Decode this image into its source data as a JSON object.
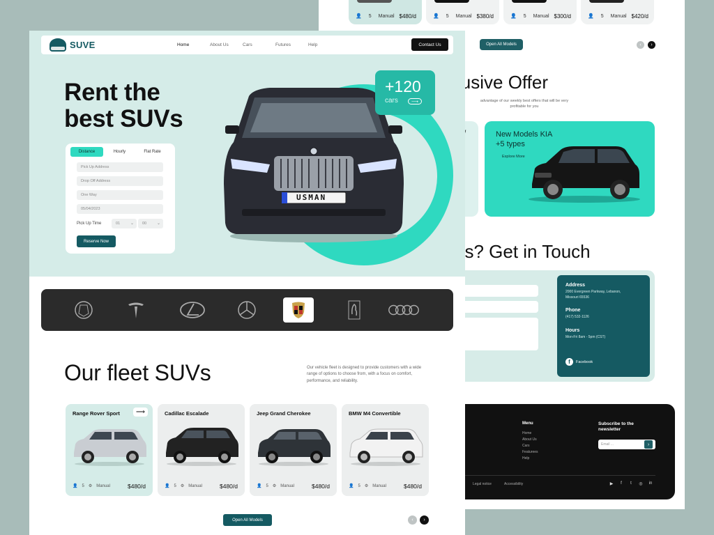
{
  "colors": {
    "teal": "#2fd9c0",
    "dark_teal": "#155a62",
    "mint": "#d5ece8",
    "dark": "#111111"
  },
  "back": {
    "top_cards": [
      {
        "seats": "5",
        "transmission": "Manual",
        "price": "$480/d"
      },
      {
        "seats": "5",
        "transmission": "Manual",
        "price": "$380/d"
      },
      {
        "seats": "5",
        "transmission": "Manual",
        "price": "$300/d"
      },
      {
        "seats": "5",
        "transmission": "Manual",
        "price": "$420/d"
      }
    ],
    "open_all_label": "Open All Models",
    "offer": {
      "title": "clusive Offer",
      "desc": "advantage of our weekly best offers that will be very profitable for you",
      "left_card_text": "E\n/",
      "card_title": "New Models KIA",
      "card_subtitle": "+5 types",
      "card_link": "Explore More"
    },
    "touch": {
      "title": "ns? Get in Touch",
      "field_name_placeholder": "n",
      "address_h": "Address",
      "address_v": "2000 Evergreen Parkway, Lebanon, Missouri 65536",
      "phone_h": "Phone",
      "phone_v": "(417) 532-1126",
      "hours_h": "Hours",
      "hours_v": "Mon-Fri 8am - 5pm (CST)",
      "facebook": "Facebook"
    },
    "footer": {
      "col1_heading": "ks",
      "menu_heading": "Menu",
      "menu_items": [
        "Home",
        "About Us",
        "Cars",
        "Featurees",
        "Help"
      ],
      "subscribe": "Subscribe to the newsletter",
      "email_placeholder": "Email ...",
      "legal": "Legal notice",
      "accessibility": "Accessibility"
    }
  },
  "front": {
    "logo": "SUVE",
    "nav": [
      "Home",
      "About Us",
      "Cars",
      "Futures",
      "Help"
    ],
    "contact_label": "Contact Us",
    "hero_title_1": "Rent the",
    "hero_title_2": "best SUVs",
    "badge_number": "+120",
    "badge_label": "cars",
    "plate": "USMAN",
    "booking": {
      "tabs": [
        "Distance",
        "Hourly",
        "Flat Rate"
      ],
      "pickup_placeholder": "Pick Up Address",
      "dropoff_placeholder": "Drop Off Address",
      "trip_type": "One Way",
      "date": "05/04/2023",
      "pickup_time_label": "Pick Up Time",
      "hour": "01",
      "minute": "00",
      "reserve_label": "Reserve Now"
    },
    "brands": [
      "Cadillac",
      "Tesla",
      "Lexus",
      "Mercedes-Benz",
      "Porsche",
      "Ferrari",
      "Audi"
    ],
    "fleet_title": "Our fleet SUVs",
    "fleet_desc": "Our vehicle fleet is designed to provide customers with a wide range of options to choose from, with a focus on comfort, performance, and reliability.",
    "cards": [
      {
        "name": "Range Rover Sport",
        "seats": "5",
        "transmission": "Manual",
        "price": "$480/d",
        "color": "#c9cdd2"
      },
      {
        "name": "Cadillac Escalade",
        "seats": "5",
        "transmission": "Manual",
        "price": "$480/d",
        "color": "#222222"
      },
      {
        "name": "Jeep Grand Cherokee",
        "seats": "5",
        "transmission": "Manual",
        "price": "$480/d",
        "color": "#2e3338"
      },
      {
        "name": "BMW M4 Convertible",
        "seats": "5",
        "transmission": "Manual",
        "price": "$480/d",
        "color": "#f2f2f2"
      }
    ],
    "open_all_label": "Open All Models"
  }
}
